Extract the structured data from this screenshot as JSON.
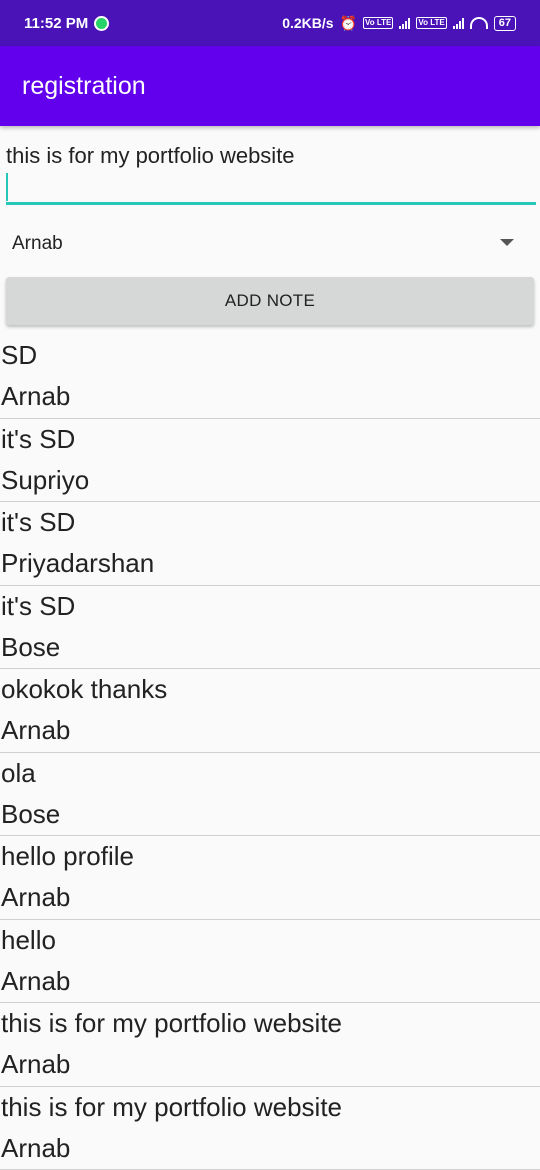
{
  "status_bar": {
    "time": "11:52 PM",
    "speed": "0.2KB/s",
    "battery": "67",
    "volte": "Vo LTE"
  },
  "app_bar": {
    "title": "registration"
  },
  "form": {
    "note_text": "this is for my portfolio website",
    "spinner_value": "Arnab",
    "add_button_label": "ADD NOTE"
  },
  "notes": [
    {
      "text": "SD",
      "author": "Arnab"
    },
    {
      "text": "it's SD",
      "author": "Supriyo"
    },
    {
      "text": "it's SD",
      "author": "Priyadarshan"
    },
    {
      "text": "it's SD",
      "author": "Bose"
    },
    {
      "text": "okokok thanks",
      "author": "Arnab"
    },
    {
      "text": "ola",
      "author": "Bose"
    },
    {
      "text": "hello profile",
      "author": "Arnab"
    },
    {
      "text": "hello",
      "author": "Arnab"
    },
    {
      "text": "this is for my portfolio website",
      "author": "Arnab"
    },
    {
      "text": "this is for my portfolio website",
      "author": "Arnab"
    }
  ],
  "colors": {
    "status_bar": "#4a13b8",
    "app_bar": "#6200ee",
    "accent": "#26c6b9",
    "button": "#d6d7d7"
  }
}
